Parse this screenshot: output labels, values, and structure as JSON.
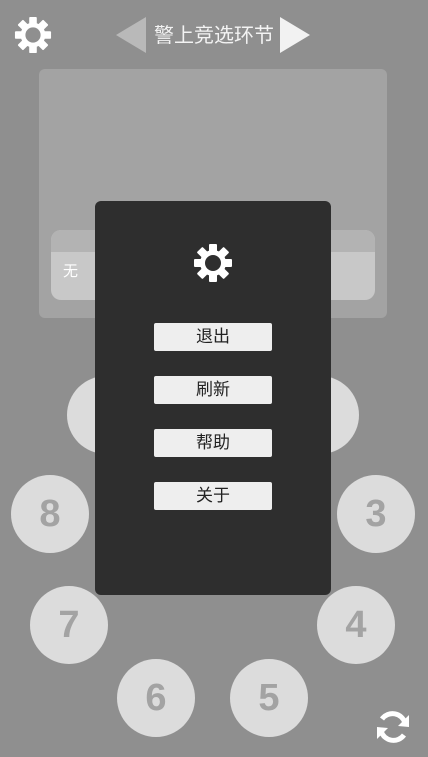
{
  "header": {
    "title": "警上竞选环节",
    "settings_icon": "gear-icon",
    "prev_icon": "triangle-left-icon",
    "next_icon": "triangle-right-icon"
  },
  "card": {
    "text": "无"
  },
  "seats": [
    {
      "label": "8"
    },
    {
      "label": "3"
    },
    {
      "label": "7"
    },
    {
      "label": "4"
    },
    {
      "label": "6"
    },
    {
      "label": "5"
    }
  ],
  "menu": {
    "icon": "gear-icon",
    "items": [
      {
        "label": "退出"
      },
      {
        "label": "刷新"
      },
      {
        "label": "帮助"
      },
      {
        "label": "关于"
      }
    ]
  },
  "footer": {
    "refresh_icon": "refresh-icon"
  },
  "colors": {
    "background": "#8f8f8f",
    "panel": "#a3a3a3",
    "dialog": "#2e2e2e",
    "seat": "#dcdcdc",
    "seat_text": "#a3a3a3"
  }
}
